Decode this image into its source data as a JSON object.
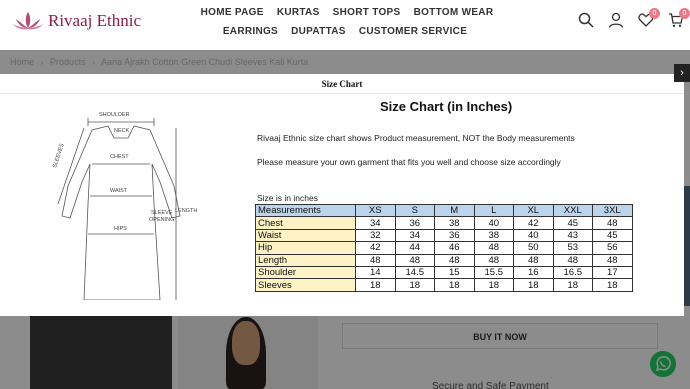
{
  "header": {
    "logo_text": "Rivaaj Ethnic",
    "nav_row1": [
      "HOME PAGE",
      "KURTAS",
      "SHORT TOPS",
      "BOTTOM WEAR"
    ],
    "nav_row2": [
      "EARRINGS",
      "DUPATTAS",
      "CUSTOMER SERVICE"
    ],
    "wishlist_count": "0",
    "cart_count": "0"
  },
  "breadcrumb": [
    "Home",
    "›",
    "Products",
    "›",
    "Aana Ajrakh Cotton Green Chudi Sleeves Kali Kurta"
  ],
  "modal": {
    "title": "Size Chart",
    "close_label": "›",
    "heading": "Size Chart (in Inches)",
    "desc1": "Rivaaj Ethnic size chart shows Product measurement, NOT the Body measurements",
    "desc2": "Please measure your own garment that fits you well and choose size accordingly",
    "unit_note": "Size is in inches",
    "diagram_labels": {
      "shoulder": "SHOULDER",
      "neck": "NECK",
      "chest": "CHEST",
      "sleeves": "SLEEVES",
      "waist": "WAIST",
      "sleeve_opening_1": "SLEEVE",
      "sleeve_opening_2": "OPENING",
      "length": "LENGTH",
      "hips": "HIPS"
    }
  },
  "size_table": {
    "header": [
      "Measurements",
      "XS",
      "S",
      "M",
      "L",
      "XL",
      "XXL",
      "3XL"
    ],
    "rows": [
      {
        "label": "Chest",
        "values": [
          "34",
          "36",
          "38",
          "40",
          "42",
          "45",
          "48"
        ]
      },
      {
        "label": "Waist",
        "values": [
          "32",
          "34",
          "36",
          "38",
          "40",
          "43",
          "45"
        ]
      },
      {
        "label": "Hip",
        "values": [
          "42",
          "44",
          "46",
          "48",
          "50",
          "53",
          "56"
        ]
      },
      {
        "label": "Length",
        "values": [
          "48",
          "48",
          "48",
          "48",
          "48",
          "48",
          "48"
        ]
      },
      {
        "label": "Shoulder",
        "values": [
          "14",
          "14.5",
          "15",
          "15.5",
          "16",
          "16.5",
          "17"
        ]
      },
      {
        "label": "Sleeves",
        "values": [
          "18",
          "18",
          "18",
          "18",
          "18",
          "18",
          "18"
        ]
      }
    ]
  },
  "page": {
    "buy_label": "BUY IT NOW",
    "secure_label": "Secure and Safe Payment"
  },
  "colors": {
    "brand": "#8a1f4a",
    "table_header": "#bcd3ec",
    "table_label": "#fdf3c7",
    "whatsapp": "#25d366"
  }
}
